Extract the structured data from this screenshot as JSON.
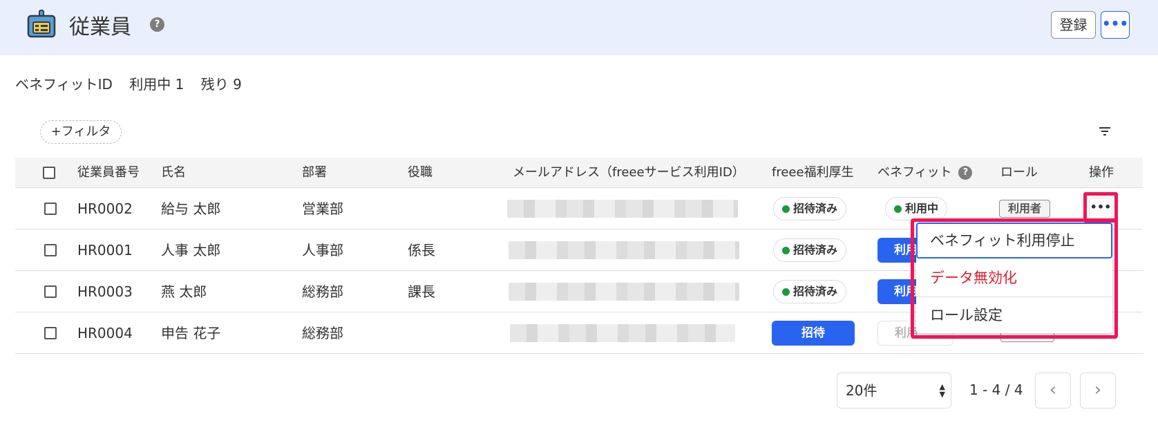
{
  "header": {
    "title": "従業員",
    "help_glyph": "?",
    "register_label": "登録",
    "more_glyph": "•••",
    "app_icon": "employee-badge-icon",
    "colors": {
      "background": "#e9f0fb",
      "icon_fill": "#5aa0d2",
      "icon_dark": "#2d3c50"
    }
  },
  "benefit_summary": {
    "label": "ベネフィットID",
    "in_use": "利用中 1",
    "remaining": "残り 9"
  },
  "toolbar": {
    "filter_label": "+フィルタ",
    "sort_icon": "filter-lines-icon"
  },
  "table": {
    "headers": {
      "employee_no": "従業員番号",
      "name": "氏名",
      "department": "部署",
      "position": "役職",
      "email": "メールアドレス（freeeサービス利用ID）",
      "freee_welfare": "freee福利厚生",
      "benefit": "ベネフィット",
      "benefit_help": "?",
      "role": "ロール",
      "actions": "操作"
    },
    "rows": [
      {
        "employee_no": "HR0002",
        "name": "給与 太郎",
        "department": "営業部",
        "position": "",
        "welfare": "招待済み",
        "benefit": "利用中",
        "role": "利用者",
        "more": "•••"
      },
      {
        "employee_no": "HR0001",
        "name": "人事 太郎",
        "department": "人事部",
        "position": "係長",
        "welfare": "招待済み",
        "benefit_partial": "利用"
      },
      {
        "employee_no": "HR0003",
        "name": "燕 太郎",
        "department": "総務部",
        "position": "課長",
        "welfare": "招待済み",
        "benefit_partial": "利用"
      },
      {
        "employee_no": "HR0004",
        "name": "申告 花子",
        "department": "総務部",
        "position": "",
        "welfare_button": "招待",
        "benefit_partial": "利用"
      }
    ]
  },
  "dropdown_menu": {
    "items": [
      {
        "label": "ベネフィット利用停止",
        "state": "focused"
      },
      {
        "label": "データ無効化",
        "state": "danger"
      },
      {
        "label": "ロール設定",
        "state": "normal"
      }
    ]
  },
  "pagination": {
    "per_page": "20件",
    "range": "1 - 4 / 4",
    "prev_glyph": "‹",
    "next_glyph": "›"
  },
  "colors": {
    "primary": "#2864f0",
    "success_dot": "#1a9a3c",
    "danger": "#dc1e32",
    "highlight": "#f0145a"
  }
}
